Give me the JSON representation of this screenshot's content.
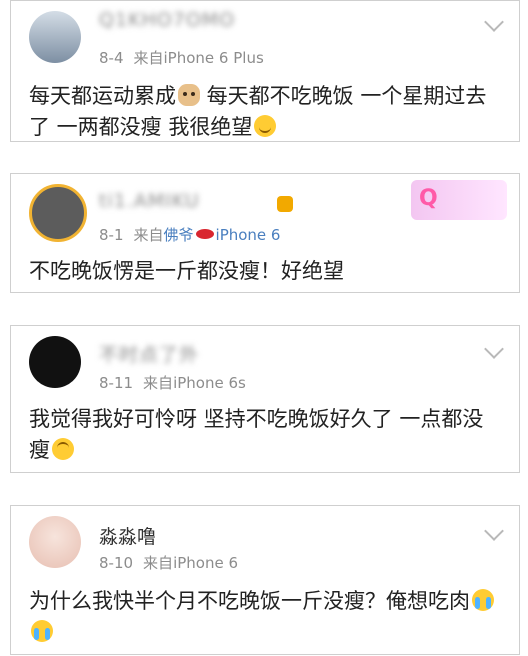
{
  "comments": [
    {
      "username": "Q1KHO7OMO",
      "date": "8-4",
      "source_prefix": "来自",
      "device": "iPhone 6 Plus",
      "text": "每天都运动累成",
      "text2": " 每天都不吃晚饭 一个星期过去了 一两都没瘦 我很绝望",
      "emoji1": "dog-face",
      "emoji2": "slightly-smiling-face",
      "avatar_color": "#9fb4c9"
    },
    {
      "username": "ti1.AMIKU",
      "date": "8-1",
      "source_prefix": "来自",
      "device_prefix": "佛爷",
      "device": "iPhone 6",
      "text": "不吃晚饭愣是一斤都没瘦！好绝望",
      "avatar_color": "#5c5c5c"
    },
    {
      "username": "不时点了外",
      "date": "8-11",
      "source_prefix": "来自",
      "device": "iPhone 6s",
      "text": "我觉得我好可怜呀 坚持不吃晚饭好久了 一点都没瘦",
      "emoji": "upside-down-face",
      "avatar_color": "#111111"
    },
    {
      "username": "淼淼噜",
      "date": "8-10",
      "source_prefix": "来自",
      "device": "iPhone 6",
      "text": "为什么我快半个月不吃晚饭一斤没瘦？俺想吃肉",
      "emoji": "loudly-crying-face",
      "avatar_color": "#f2d6cf"
    }
  ]
}
